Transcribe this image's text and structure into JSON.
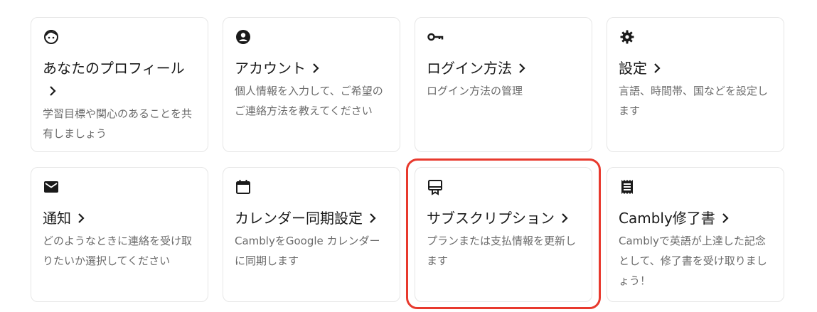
{
  "cards": [
    {
      "icon": "face-icon",
      "title": "あなたのプロフィール",
      "description": "学習目標や関心のあることを共有しましょう"
    },
    {
      "icon": "account-circle-icon",
      "title": "アカウント",
      "description": "個人情報を入力して、ご希望のご連絡方法を教えてください"
    },
    {
      "icon": "key-icon",
      "title": "ログイン方法",
      "description": "ログイン方法の管理"
    },
    {
      "icon": "gear-icon",
      "title": "設定",
      "description": "言語、時間帯、国などを設定します"
    },
    {
      "icon": "mail-icon",
      "title": "通知",
      "description": "どのようなときに連絡を受け取りたいか選択してください"
    },
    {
      "icon": "calendar-icon",
      "title": "カレンダー同期設定",
      "description": "CamblyをGoogle カレンダーに同期します"
    },
    {
      "icon": "card-membership-icon",
      "title": "サブスクリプション",
      "description": "プランまたは支払情報を更新します",
      "highlighted": true
    },
    {
      "icon": "receipt-icon",
      "title": "Cambly修了書",
      "description": "Camblyで英語が上達した記念として、修了書を受け取りましょう！"
    }
  ],
  "colors": {
    "highlight_border": "#e8392d",
    "description_text": "#6b6b6b",
    "card_border": "#e6e6e6"
  }
}
